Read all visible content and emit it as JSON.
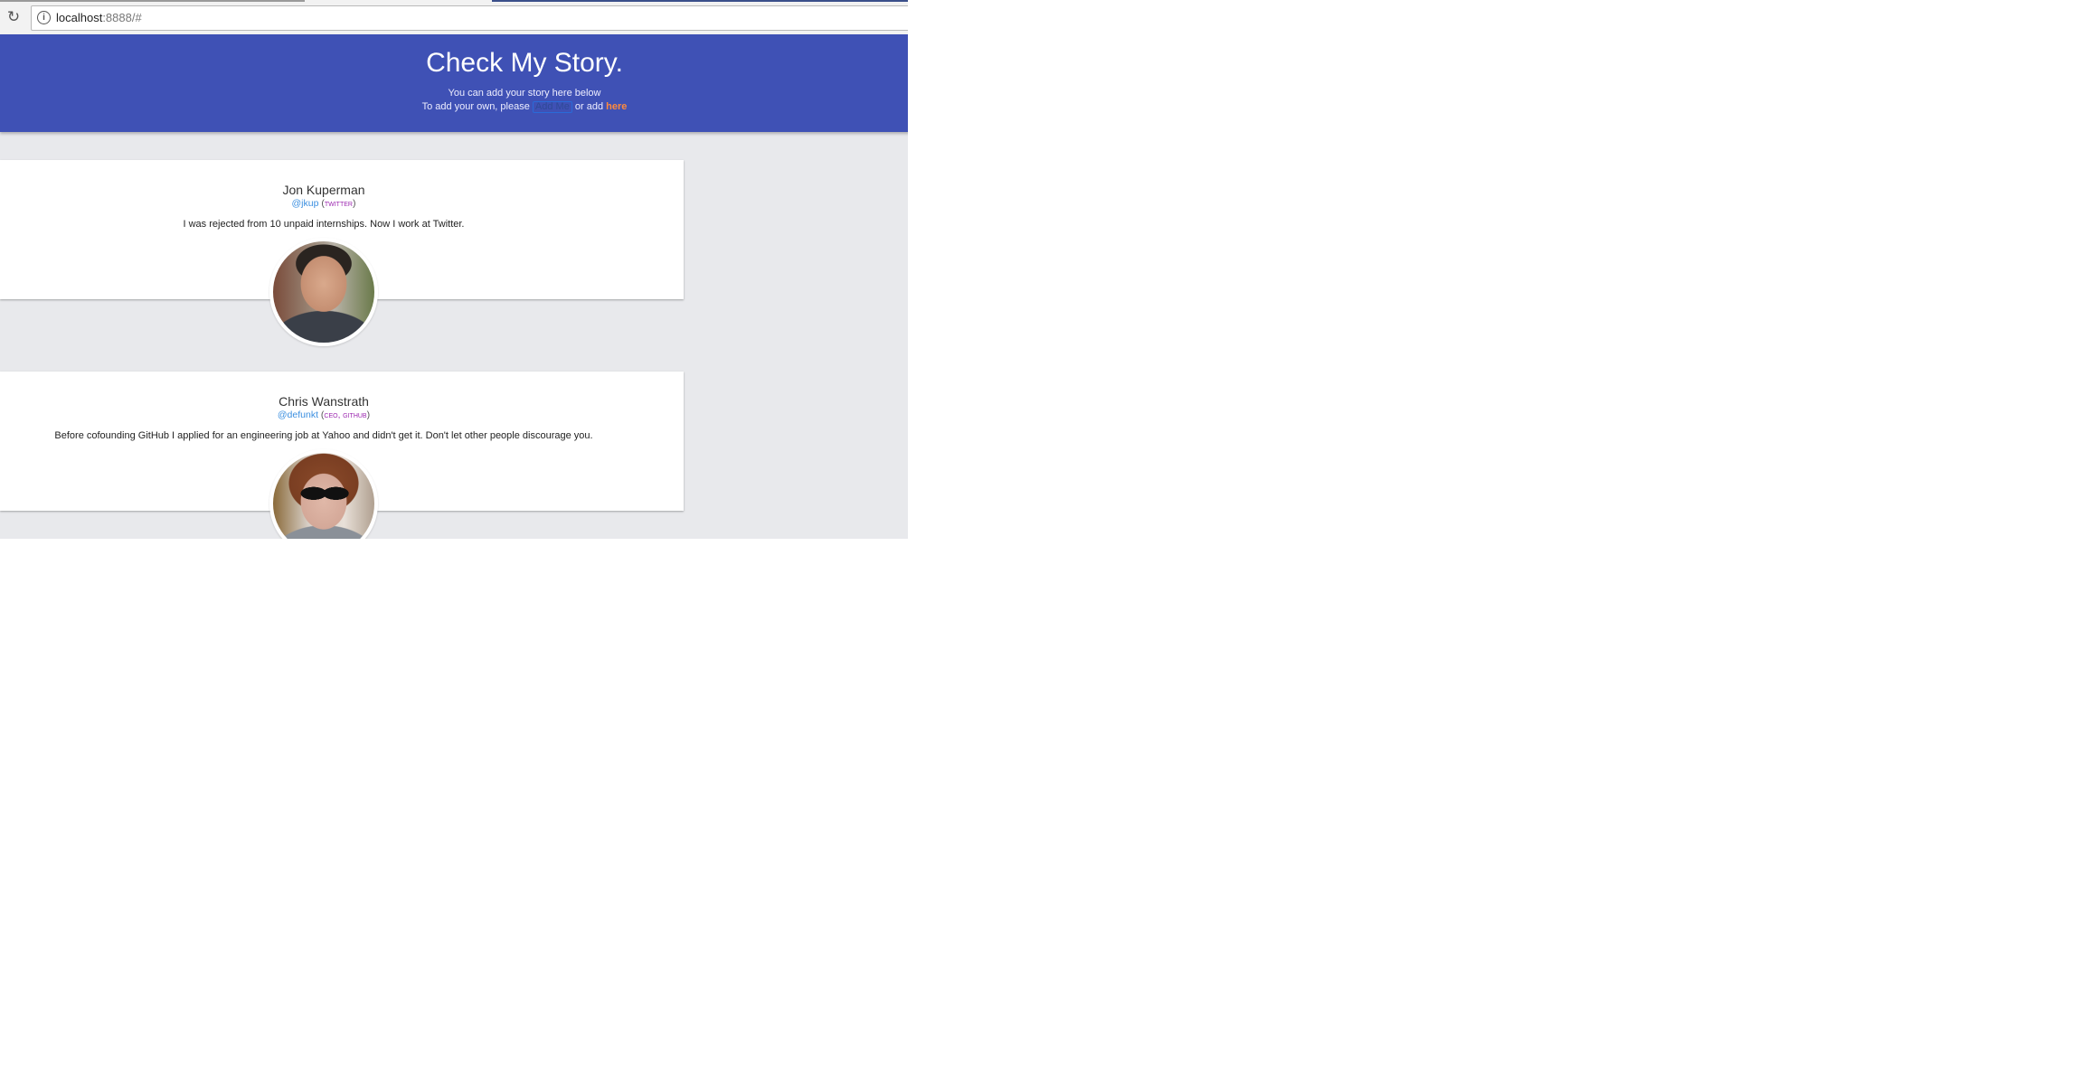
{
  "browser": {
    "reload_icon": "reload-icon",
    "info_icon": "info-icon",
    "url_host": "localhost",
    "url_rest": ":8888/#"
  },
  "header": {
    "title": "Check My Story.",
    "subtitle": "You can add your story here below",
    "add_prefix": "To add your own, please",
    "add_me_label": "Add Me",
    "add_middle": "or add",
    "here_label": "here"
  },
  "colors": {
    "header_bg": "#3f51b5",
    "link": "#3b8fe0",
    "role": "#9c27b0",
    "here": "#ff8a3d",
    "page_bg": "#e8e9ec"
  },
  "stories": [
    {
      "name": "Jon Kuperman",
      "handle": "@jkup",
      "role": "TWITTER",
      "story": "I was rejected from 10 unpaid internships. Now I work at Twitter."
    },
    {
      "name": "Chris Wanstrath",
      "handle": "@defunkt",
      "role": "CEO, GITHUB",
      "story": "Before cofounding GitHub I applied for an engineering job at Yahoo and didn't get it. Don't let other people discourage you."
    }
  ]
}
